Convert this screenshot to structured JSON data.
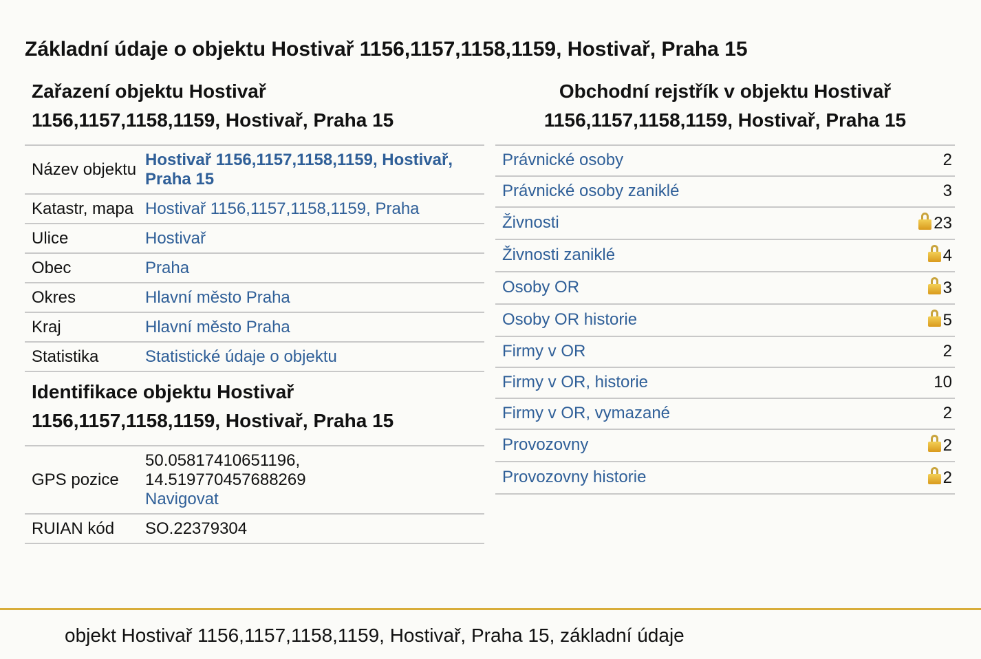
{
  "title": "Základní údaje o objektu Hostivař 1156,1157,1158,1159, Hostivař, Praha 15",
  "classification": {
    "heading_line1": "Zařazení objektu Hostivař",
    "heading_line2": "1156,1157,1158,1159, Hostivař, Praha 15",
    "rows": [
      {
        "label": "Název objektu",
        "value": "Hostivař 1156,1157,1158,1159, Hostivař, Praha 15"
      },
      {
        "label": "Katastr, mapa",
        "value": "Hostivař 1156,1157,1158,1159, Praha"
      },
      {
        "label": "Ulice",
        "value": "Hostivař"
      },
      {
        "label": "Obec",
        "value": "Praha"
      },
      {
        "label": "Okres",
        "value": "Hlavní město Praha"
      },
      {
        "label": "Kraj",
        "value": "Hlavní město Praha"
      },
      {
        "label": "Statistika",
        "value": "Statistické údaje o objektu"
      }
    ]
  },
  "identification": {
    "heading_line1": "Identifikace objektu Hostivař",
    "heading_line2": "1156,1157,1158,1159, Hostivař, Praha 15",
    "gps_label": "GPS pozice",
    "gps_lat": "50.05817410651196,",
    "gps_lon": "14.519770457688269",
    "navigate_link": "Navigovat",
    "ruian_label": "RUIAN kód",
    "ruian_value": "SO.22379304"
  },
  "registry": {
    "heading_line1": "Obchodní rejstřík v objektu Hostivař",
    "heading_line2": "1156,1157,1158,1159, Hostivař, Praha 15",
    "rows": [
      {
        "label": "Právnické osoby",
        "count": "2",
        "locked": false
      },
      {
        "label": "Právnické osoby zaniklé",
        "count": "3",
        "locked": false
      },
      {
        "label": "Živnosti",
        "count": "23",
        "locked": true
      },
      {
        "label": "Živnosti zaniklé",
        "count": "4",
        "locked": true
      },
      {
        "label": "Osoby OR",
        "count": "3",
        "locked": true
      },
      {
        "label": "Osoby OR historie",
        "count": "5",
        "locked": true
      },
      {
        "label": "Firmy v OR",
        "count": "2",
        "locked": false
      },
      {
        "label": "Firmy v OR, historie",
        "count": "10",
        "locked": false
      },
      {
        "label": "Firmy v OR, vymazané",
        "count": "2",
        "locked": false
      },
      {
        "label": "Provozovny",
        "count": "2",
        "locked": true
      },
      {
        "label": "Provozovny historie",
        "count": "2",
        "locked": true
      }
    ],
    "lock_icon": "lock-icon"
  },
  "footer": {
    "text": "objekt Hostivař 1156,1157,1158,1159, Hostivař, Praha 15, základní údaje"
  },
  "colors": {
    "link": "#2f5f98",
    "accent_rule": "#d8ad3a",
    "background": "#fbfbf8"
  }
}
